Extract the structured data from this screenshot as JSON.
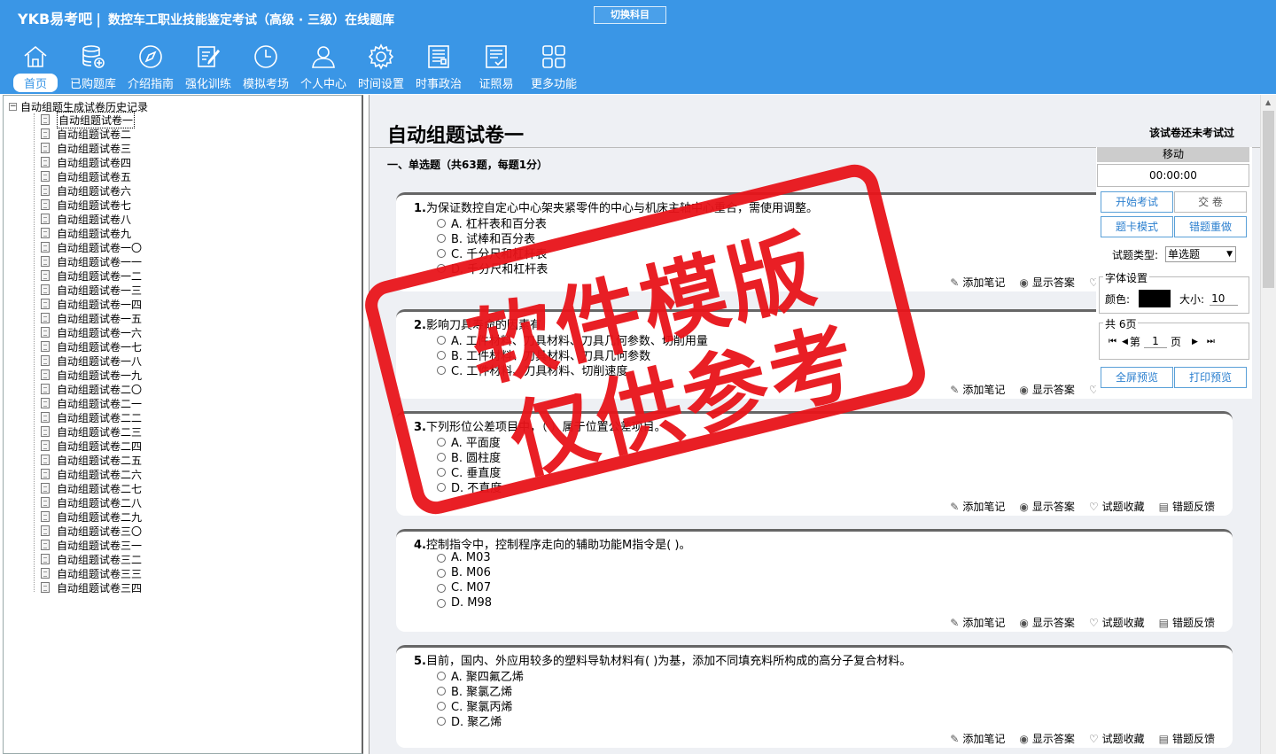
{
  "app": {
    "brand": "YKB易考吧",
    "title": "数控车工职业技能鉴定考试（高级 · 三级）在线题库",
    "switch_subject": "切换科目"
  },
  "nav": [
    {
      "label": "首页",
      "icon": "home-icon"
    },
    {
      "label": "已购题库",
      "icon": "database-icon"
    },
    {
      "label": "介绍指南",
      "icon": "compass-icon"
    },
    {
      "label": "强化训练",
      "icon": "edit-icon"
    },
    {
      "label": "模拟考场",
      "icon": "clock-icon"
    },
    {
      "label": "个人中心",
      "icon": "user-icon"
    },
    {
      "label": "时间设置",
      "icon": "gear-icon"
    },
    {
      "label": "时事政治",
      "icon": "news-icon"
    },
    {
      "label": "证照易",
      "icon": "certificate-icon"
    },
    {
      "label": "更多功能",
      "icon": "grid-icon"
    }
  ],
  "tree": {
    "root": "自动组题生成试卷历史记录",
    "items": [
      "自动组题试卷一",
      "自动组题试卷二",
      "自动组题试卷三",
      "自动组题试卷四",
      "自动组题试卷五",
      "自动组题试卷六",
      "自动组题试卷七",
      "自动组题试卷八",
      "自动组题试卷九",
      "自动组题试卷一〇",
      "自动组题试卷一一",
      "自动组题试卷一二",
      "自动组题试卷一三",
      "自动组题试卷一四",
      "自动组题试卷一五",
      "自动组题试卷一六",
      "自动组题试卷一七",
      "自动组题试卷一八",
      "自动组题试卷一九",
      "自动组题试卷二〇",
      "自动组题试卷二一",
      "自动组题试卷二二",
      "自动组题试卷二三",
      "自动组题试卷二四",
      "自动组题试卷二五",
      "自动组题试卷二六",
      "自动组题试卷二七",
      "自动组题试卷二八",
      "自动组题试卷二九",
      "自动组题试卷三〇",
      "自动组题试卷三一",
      "自动组题试卷三二",
      "自动组题试卷三三",
      "自动组题试卷三四"
    ]
  },
  "exam": {
    "title": "自动组题试卷一",
    "status": "该试卷还未考试过",
    "section": "一、单选题（共63题，每题1分）"
  },
  "actions": {
    "note": "添加笔记",
    "answer": "显示答案",
    "favorite": "试题收藏",
    "feedback": "错题反馈"
  },
  "questions": [
    {
      "num": "1.",
      "text": "为保证数控自定心中心架夹紧零件的中心与机床主轴中心重合，需使用调整。",
      "options": [
        "A. 杠杆表和百分表",
        "B. 试棒和百分表",
        "C. 千分尺和杠杆表",
        "D. 千分尺和杠杆表"
      ]
    },
    {
      "num": "2.",
      "text": "影响刀具寿命的因素有",
      "options": [
        "A. 工件材料、刀具材料、刀具几何参数、切削用量",
        "B. 工件材料、刀具材料、刀具几何参数",
        "C. 工件材料、刀具材料、切削速度"
      ]
    },
    {
      "num": "3.",
      "text": "下列形位公差项目中，（ ）属于位置公差项目。",
      "options": [
        "A. 平面度",
        "B. 圆柱度",
        "C. 垂直度",
        "D. 不直度"
      ]
    },
    {
      "num": "4.",
      "text": "控制指令中，控制程序走向的辅助功能M指令是( )。",
      "options": [
        "A. M03",
        "B. M06",
        "C. M07",
        "D. M98"
      ]
    },
    {
      "num": "5.",
      "text": "目前，国内、外应用较多的塑料导轨材料有( )为基，添加不同填充料所构成的高分子复合材料。",
      "options": [
        "A. 聚四氟乙烯",
        "B. 聚氯乙烯",
        "C. 聚氯丙烯",
        "D. 聚乙烯"
      ]
    }
  ],
  "panel": {
    "header": "移动",
    "timer": "00:00:00",
    "start": "开始考试",
    "submit": "交  卷",
    "card_mode": "题卡模式",
    "redo_wrong": "错题重做",
    "type_label": "试题类型:",
    "type_value": "单选题",
    "font_legend": "字体设置",
    "color_label": "颜色:",
    "size_label": "大小:",
    "size_value": "10",
    "pages_legend": "共 6页",
    "page_prefix": "第",
    "page_value": "1",
    "page_suffix": "页",
    "fullscreen": "全屏预览",
    "print": "打印预览",
    "color_value": "#000000"
  },
  "watermark": {
    "line1": "软件模版",
    "line2": "仅供参考"
  },
  "colors": {
    "header_bg": "#3a96e6",
    "stamp": "#e8141a"
  }
}
